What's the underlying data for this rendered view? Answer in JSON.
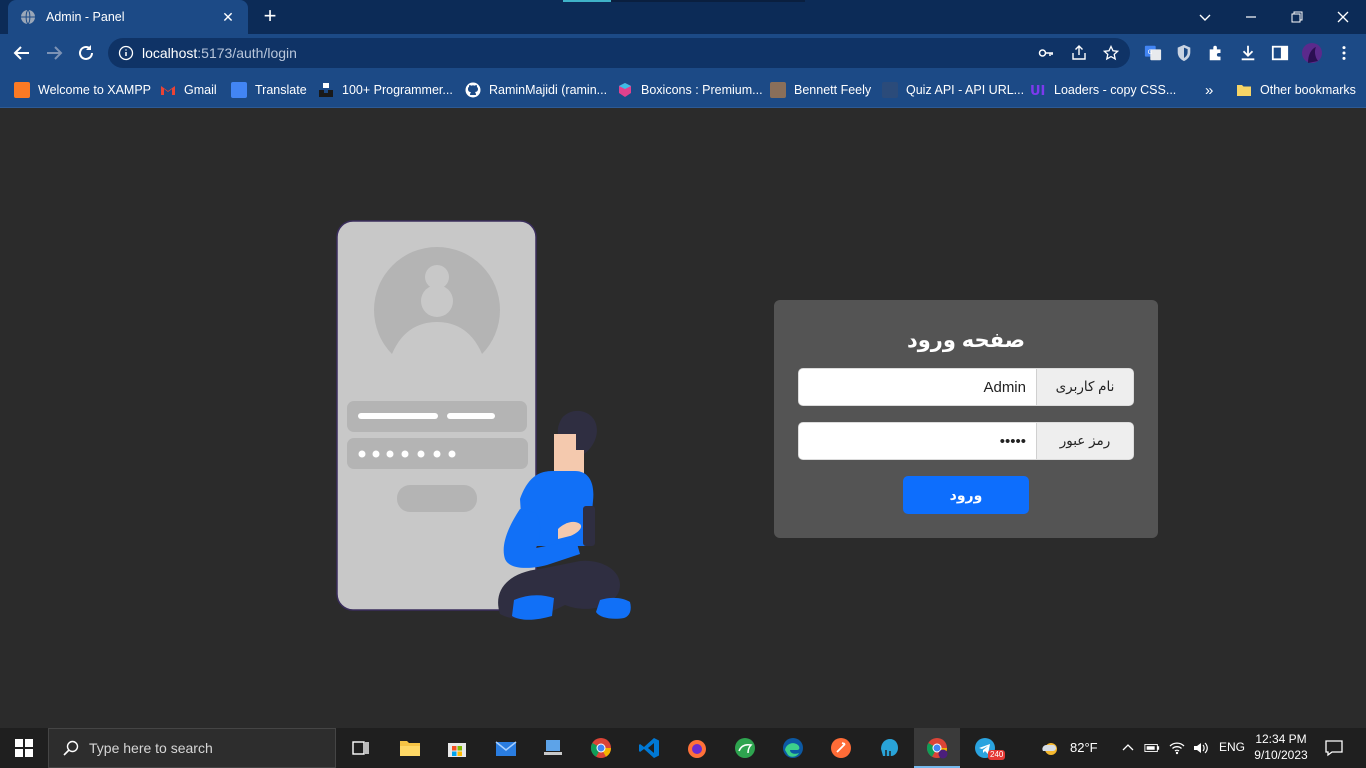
{
  "browser": {
    "tab_title": "Admin - Panel",
    "url_host": "localhost",
    "url_rest": ":5173/auth/login",
    "bookmarks": [
      {
        "label": "Welcome to XAMPP",
        "icon": "xampp-icon",
        "color": "#fb7a24"
      },
      {
        "label": "Gmail",
        "icon": "gmail-icon",
        "color": "#ea4335"
      },
      {
        "label": "Translate",
        "icon": "translate-icon",
        "color": "#4285f4"
      },
      {
        "label": "100+ Programmer...",
        "icon": "unsplash-icon",
        "color": "#000000"
      },
      {
        "label": "RaminMajidi (ramin...",
        "icon": "github-icon",
        "color": "#ffffff"
      },
      {
        "label": "Boxicons : Premium...",
        "icon": "boxicons-icon",
        "color": "#e0418d"
      },
      {
        "label": "Bennett Feely",
        "icon": "avatar-icon",
        "color": "#8a6f5a"
      },
      {
        "label": "Quiz API - API URL...",
        "icon": "quizapi-icon",
        "color": "#2b4b7a"
      },
      {
        "label": "Loaders - copy CSS...",
        "icon": "uiverse-icon",
        "color": "#7c3aed"
      }
    ],
    "more_label": "»",
    "other_bookmarks": "Other bookmarks"
  },
  "login": {
    "title": "صفحه ورود",
    "username_label": "نام کاربری",
    "username_value": "Admin",
    "password_label": "رمز عبور",
    "password_value": "•••••",
    "submit_label": "ورود"
  },
  "taskbar": {
    "search_placeholder": "Type here to search",
    "weather": "82°F",
    "language": "ENG",
    "time": "12:34 PM",
    "date": "9/10/2023",
    "telegram_badge": "240"
  },
  "colors": {
    "accent": "#0d6efd",
    "card": "#545454",
    "page_bg": "#2b2b2b",
    "chrome": "#1c4a86"
  }
}
